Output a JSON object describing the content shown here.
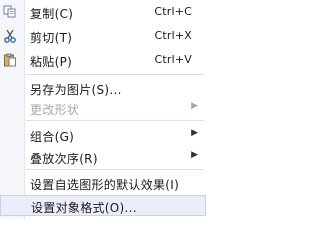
{
  "menu": {
    "copy": {
      "label": "复制(C)",
      "shortcut": "Ctrl+C",
      "icon": "copy-icon"
    },
    "cut": {
      "label": "剪切(T)",
      "shortcut": "Ctrl+X",
      "icon": "scissors-icon"
    },
    "paste": {
      "label": "粘贴(P)",
      "shortcut": "Ctrl+V",
      "icon": "clipboard-icon"
    },
    "save_as_picture": {
      "label": "另存为图片(S)..."
    },
    "change_shape": {
      "label": "更改形状"
    },
    "group": {
      "label": "组合(G)"
    },
    "order": {
      "label": "叠放次序(R)"
    },
    "set_default_effect": {
      "label": "设置自选图形的默认效果(I)"
    },
    "format_object": {
      "label": "设置对象格式(O)..."
    }
  }
}
